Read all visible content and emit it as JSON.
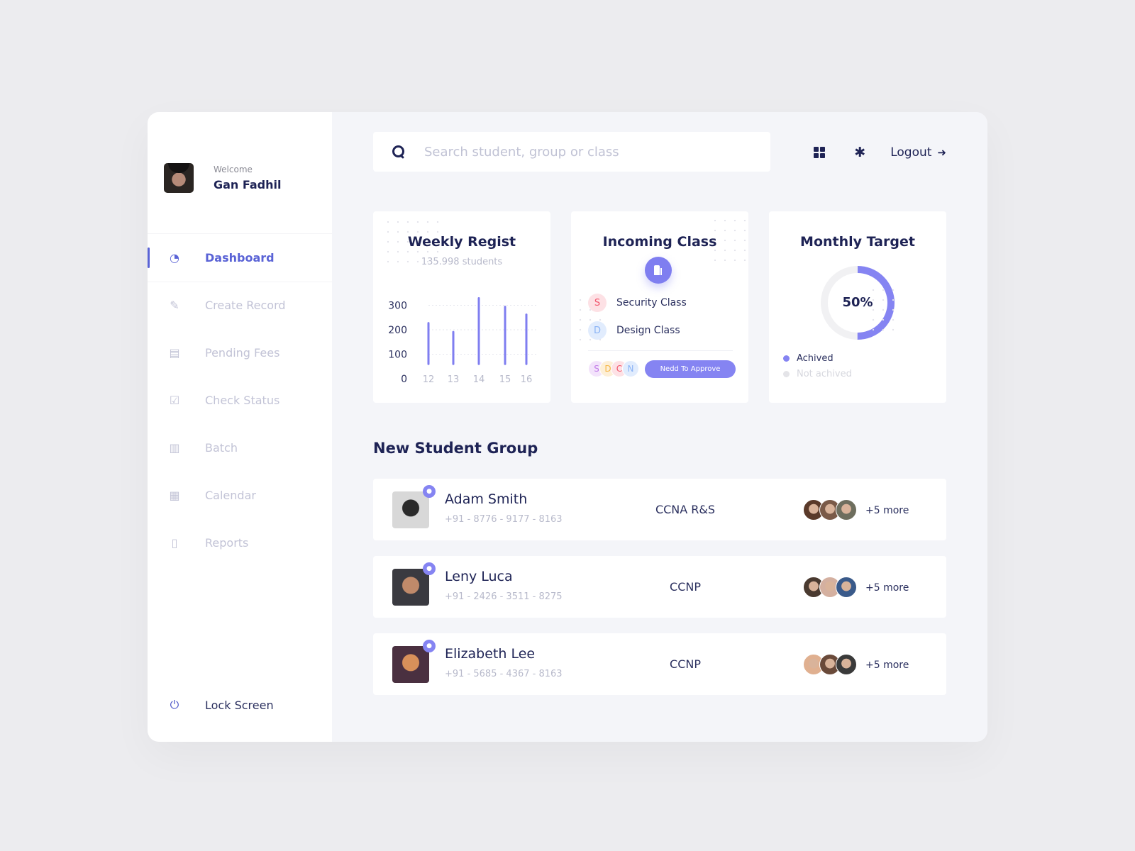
{
  "profile": {
    "welcome": "Welcome",
    "name": "Gan Fadhil"
  },
  "sidebar": {
    "items": [
      {
        "label": "Dashboard",
        "icon": "dashboard-icon",
        "glyph": "◔",
        "active": true
      },
      {
        "label": "Create Record",
        "icon": "edit-icon",
        "glyph": "✎",
        "active": false
      },
      {
        "label": "Pending Fees",
        "icon": "credit-card-icon",
        "glyph": "▤",
        "active": false
      },
      {
        "label": "Check Status",
        "icon": "check-square-icon",
        "glyph": "☑",
        "active": false
      },
      {
        "label": "Batch",
        "icon": "clipboard-icon",
        "glyph": "▥",
        "active": false
      },
      {
        "label": "Calendar",
        "icon": "calendar-icon",
        "glyph": "▦",
        "active": false
      },
      {
        "label": "Reports",
        "icon": "file-icon",
        "glyph": "▯",
        "active": false
      }
    ],
    "lock": {
      "label": "Lock Screen",
      "glyph": "⏻"
    }
  },
  "search": {
    "placeholder": "Search student, group or class",
    "value": ""
  },
  "topbar": {
    "logout_label": "Logout",
    "logout_glyph": "➜",
    "gear_glyph": "✱"
  },
  "weekly": {
    "title": "Weekly Regist",
    "subtitle": "135.998 students"
  },
  "incoming": {
    "title": "Incoming Class",
    "classes": [
      {
        "initial": "S",
        "name": "Security Class",
        "color": "#f2546c",
        "bg": "#fde1e5"
      },
      {
        "initial": "D",
        "name": "Design Class",
        "color": "#8ab3f5",
        "bg": "#e1ecfd"
      }
    ],
    "stack": [
      {
        "initial": "S",
        "color": "#c17be8",
        "bg": "#f3e3fb"
      },
      {
        "initial": "D",
        "color": "#f5b545",
        "bg": "#fdefd7"
      },
      {
        "initial": "C",
        "color": "#f2546c",
        "bg": "#fde1e5"
      },
      {
        "initial": "N",
        "color": "#8ab3f5",
        "bg": "#e1ecfd"
      }
    ],
    "approve_label": "Nedd To Approve"
  },
  "monthly": {
    "title": "Monthly Target",
    "percent_label": "50%",
    "achieved_fraction": 0.5,
    "legend": [
      {
        "label": "Achived",
        "color": "#8584f2"
      },
      {
        "label": "Not achived",
        "color": "#e4e4e8"
      }
    ]
  },
  "chart_data": {
    "type": "bar",
    "title": "Weekly Regist",
    "subtitle": "135.998 students",
    "categories": [
      "12",
      "13",
      "14",
      "15",
      "16"
    ],
    "values": [
      227,
      191,
      329,
      294,
      262
    ],
    "bar_base": 60,
    "yticks": [
      0,
      100,
      200,
      300
    ],
    "ylim": [
      0,
      300
    ],
    "grid": true,
    "xlabel": "",
    "ylabel": "",
    "color": "#7f7ef0"
  },
  "students": {
    "title": "New Student Group",
    "rows": [
      {
        "name": "Adam Smith",
        "phone": "+91 - 8776 - 9177 - 8163",
        "course": "CCNA R&S",
        "more": "+5 more",
        "photo": [
          "#d8d8d8",
          "#2a2a2a"
        ],
        "members": [
          "#5a3a2a",
          "#7a5a48",
          "#6e6e5e"
        ]
      },
      {
        "name": "Leny Luca",
        "phone": "+91 - 2426 - 3511 - 8275",
        "course": "CCNP",
        "more": "+5 more",
        "photo": [
          "#3a3a40",
          "#c08a6a"
        ],
        "members": [
          "#4a3a30",
          "#d4b0a0",
          "#3a5a8a"
        ]
      },
      {
        "name": "Elizabeth Lee",
        "phone": "+91 - 5685 - 4367 - 8163",
        "course": "CCNP",
        "more": "+5 more",
        "photo": [
          "#4a3040",
          "#d8905a"
        ],
        "members": [
          "#e0b090",
          "#6a4a3a",
          "#3a3a3a"
        ]
      }
    ]
  }
}
